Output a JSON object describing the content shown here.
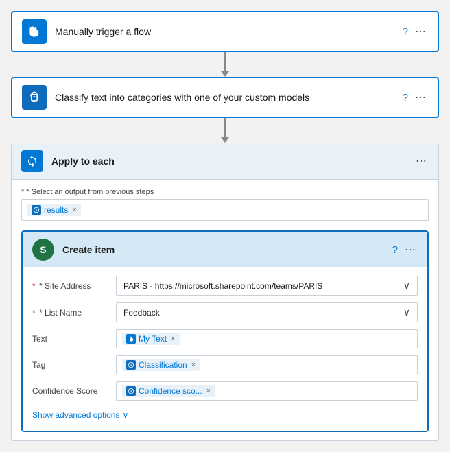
{
  "trigger": {
    "title": "Manually trigger a flow",
    "iconType": "hand"
  },
  "classify": {
    "title": "Classify text into categories with one of your custom models",
    "iconType": "brain"
  },
  "applyToEach": {
    "title": "Apply to each",
    "outputLabel": "* Select an output from previous steps",
    "outputTag": "results",
    "createItem": {
      "title": "Create item",
      "iconLetter": "S",
      "fields": {
        "siteAddress": {
          "label": "* Site Address",
          "value": "PARIS - https://microsoft.sharepoint.com/teams/PARIS"
        },
        "listName": {
          "label": "* List Name",
          "value": "Feedback"
        },
        "text": {
          "label": "Text",
          "pill": "My Text",
          "pillType": "trigger"
        },
        "tag": {
          "label": "Tag",
          "pill": "Classification",
          "pillType": "classify"
        },
        "confidenceScore": {
          "label": "Confidence Score",
          "pill": "Confidence sco...",
          "pillType": "classify"
        }
      },
      "showAdvanced": "Show advanced options"
    }
  }
}
